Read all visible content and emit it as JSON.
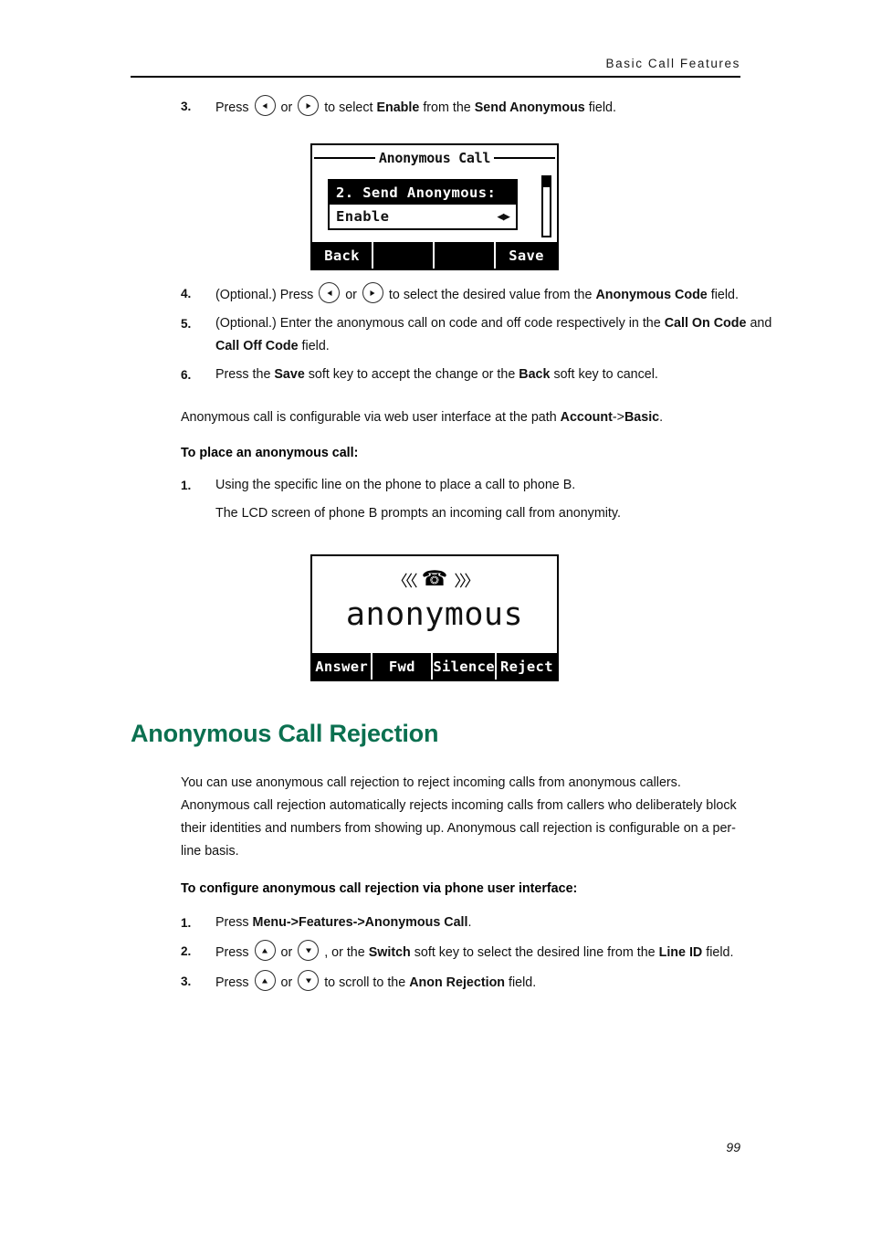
{
  "header": {
    "title": "Basic Call Features"
  },
  "footer": {
    "page_number": "99"
  },
  "steps_send_anonymous": {
    "step3": {
      "num": "3.",
      "pre": "Press",
      "mid": "or",
      "post1": "to select",
      "bold1": "Enable",
      "post2": "from the",
      "bold2": "Send Anonymous",
      "post3": "field."
    },
    "step4": {
      "num": "4.",
      "pre": "(Optional.) Press",
      "mid": "or",
      "post1": "to select the desired value from the",
      "bold1": "Anonymous Code",
      "post2": "field."
    },
    "step5": {
      "num": "5.",
      "pre": "(Optional.) Enter the anonymous call on code and off code respectively in the",
      "bold1": "Call On Code",
      "mid": "and",
      "bold2": "Call Off Code",
      "post": "field."
    },
    "step6": {
      "num": "6.",
      "pre": "Press the",
      "bold1": "Save",
      "mid": "soft key to accept the change or the",
      "bold2": "Back",
      "post": "soft key to cancel."
    }
  },
  "note_web_ui": {
    "pre": "Anonymous call is configurable via web user interface at the path",
    "bold": "Account",
    "arrow": "->",
    "bold2": "Basic",
    "post": "."
  },
  "place_call": {
    "subhead": "To place an anonymous call:",
    "step1": {
      "num": "1.",
      "text": "Using the specific line on the phone to place a call to phone B.",
      "sub": "The LCD screen of phone B prompts an incoming call from anonymity."
    }
  },
  "lcd_menu": {
    "title": "Anonymous Call",
    "selected_row": "2. Send Anonymous:",
    "value": "Enable",
    "value_arrows": "◀▶",
    "softkeys": [
      "Back",
      "",
      "",
      "Save"
    ]
  },
  "lcd_incoming": {
    "chevron_left": "〈〈〈",
    "phone_icon": "☎",
    "chevron_right": "〉〉〉",
    "caller": "anonymous",
    "softkeys": [
      "Answer",
      "Fwd",
      "Silence",
      "Reject"
    ]
  },
  "section": {
    "heading": "Anonymous Call Rejection",
    "heading_color": "#0b7050",
    "paragraph": "You can use anonymous call rejection to reject incoming calls from anonymous callers. Anonymous call rejection automatically rejects incoming calls from callers who deliberately block their identities and numbers from showing up. Anonymous call rejection is configurable on a per-line basis.",
    "subhead": "To configure anonymous call rejection via phone user interface:",
    "step1": {
      "num": "1.",
      "pre": "Press",
      "bold": "Menu->Features->Anonymous Call",
      "post": "."
    },
    "step2": {
      "num": "2.",
      "pre": "Press",
      "mid": "or",
      "comma": ", or the",
      "bold1": "Switch",
      "post1": "soft key to select the desired line from the",
      "bold2": "Line ID",
      "post2": "field."
    },
    "step3": {
      "num": "3.",
      "pre": "Press",
      "mid": "or",
      "post1": "to scroll to the",
      "bold1": "Anon Rejection",
      "post2": "field."
    }
  }
}
